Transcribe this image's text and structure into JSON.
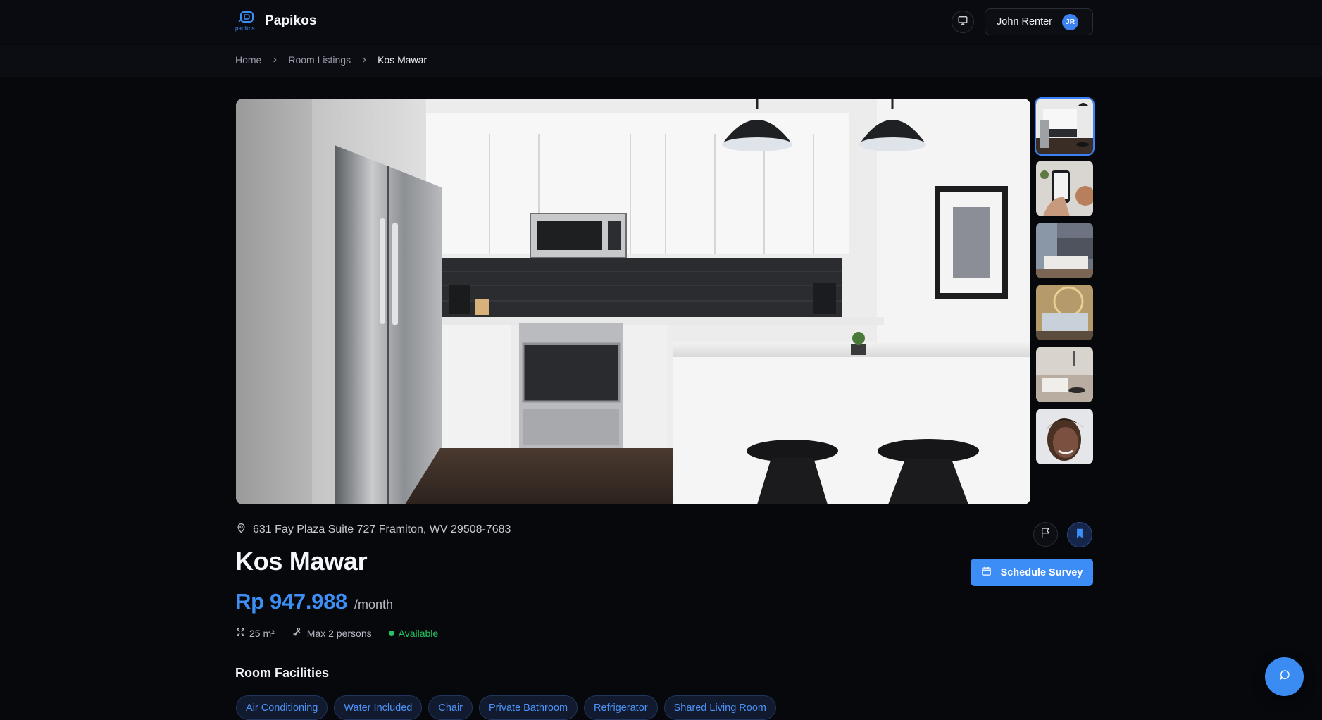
{
  "header": {
    "brand_name": "Papikos",
    "logo_text": "papikos",
    "user_name": "John Renter",
    "user_initials": "JR"
  },
  "breadcrumb": {
    "items": [
      "Home",
      "Room Listings",
      "Kos Mawar"
    ]
  },
  "gallery": {
    "thumbnail_count": 6,
    "active_index": 0,
    "thumbnails": [
      "kitchen",
      "phone-in-hand",
      "bedroom-blue",
      "bedroom-gold",
      "living-room",
      "portrait"
    ]
  },
  "listing": {
    "address": "631 Fay Plaza Suite 727 Framiton, WV 29508-7683",
    "title": "Kos Mawar",
    "price": "Rp 947.988",
    "price_unit": "/month",
    "size": "25 m²",
    "capacity": "Max 2 persons",
    "status": "Available"
  },
  "actions": {
    "schedule_label": "Schedule Survey"
  },
  "facilities": {
    "title": "Room Facilities",
    "items": [
      "Air Conditioning",
      "Water Included",
      "Chair",
      "Private Bathroom",
      "Refrigerator",
      "Shared Living Room"
    ]
  },
  "colors": {
    "accent": "#3c8ef6",
    "status_available": "#22c55e",
    "background": "#07080c"
  },
  "icons": {
    "header": [
      "monitor-icon"
    ],
    "address": "map-pin-icon",
    "specs": [
      "expand-icon",
      "person-icon"
    ],
    "actions": [
      "flag-icon",
      "bookmark-icon",
      "calendar-icon"
    ],
    "fab": "chat-icon"
  }
}
